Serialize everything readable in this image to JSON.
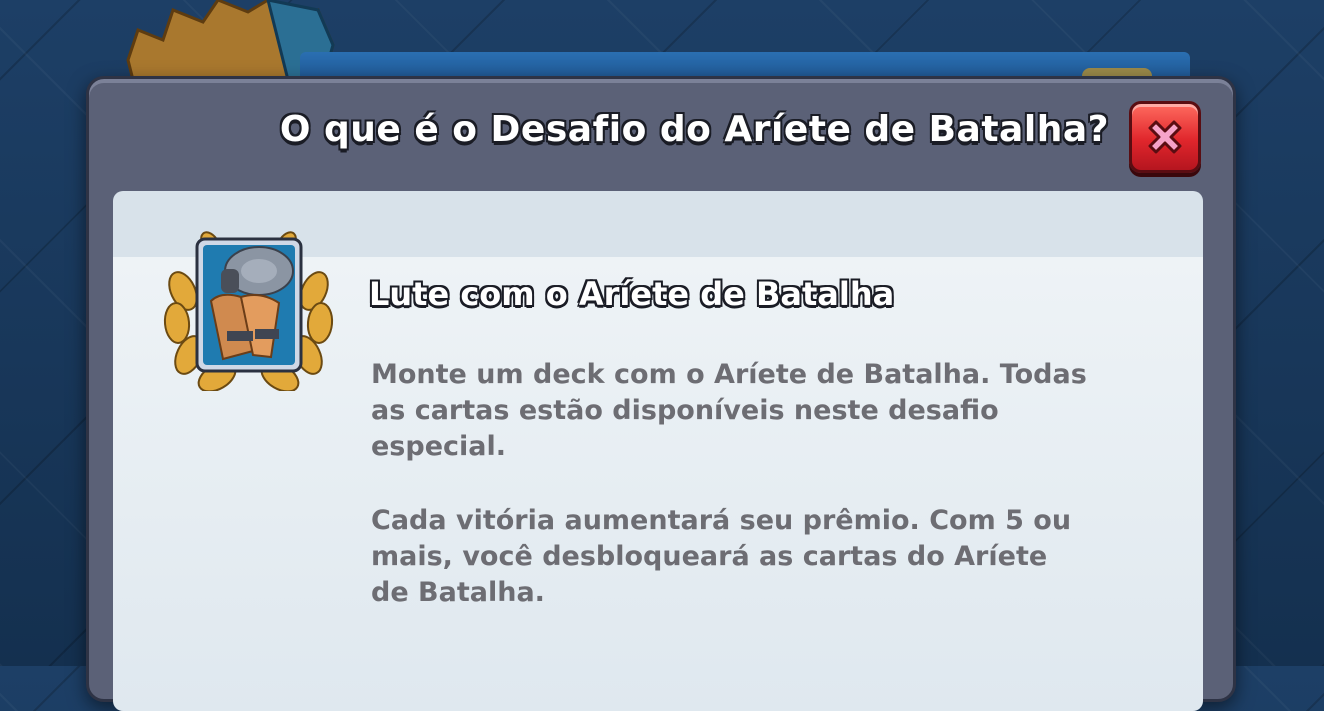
{
  "modal": {
    "title": "O que é o Desafio do Aríete de Batalha?",
    "close_icon": "close-x-icon"
  },
  "challenge": {
    "badge_icon": "battle-ram-card-laurel-icon",
    "title": "Lute com o Aríete de Batalha",
    "paragraphs": [
      "Monte um deck com o Aríete de Batalha. Todas as cartas estão disponíveis neste desafio especial.",
      "Cada vitória aumentará seu prêmio. Com 5 ou mais, você desbloqueará as cartas do Aríete de Batalha."
    ]
  },
  "colors": {
    "modal_frame": "#5b6177",
    "content_bg": "#eef3f6",
    "close_button": "#e0262c",
    "description_text": "#6d6d73"
  }
}
